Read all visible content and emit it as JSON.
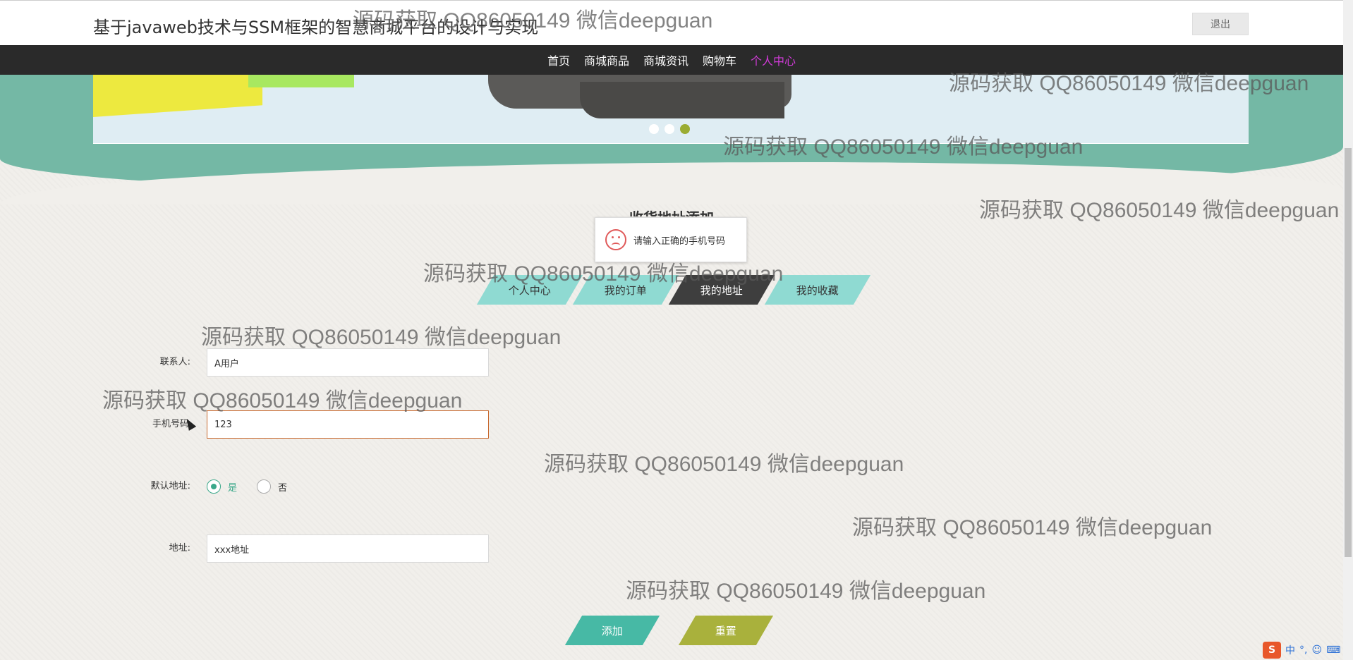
{
  "header": {
    "site_title": "基于javaweb技术与SSM框架的智慧商城平台的设计与实现",
    "logout_label": "退出"
  },
  "nav": {
    "items": [
      "首页",
      "商城商品",
      "商城资讯",
      "购物车",
      "个人中心"
    ],
    "active_index": 4
  },
  "banner": {
    "slide_count": 3,
    "active_slide": 3
  },
  "section_title": "收货地址添加",
  "toast": {
    "message": "请输入正确的手机号码",
    "icon": "sad-face-icon"
  },
  "tabs": {
    "items": [
      "个人中心",
      "我的订单",
      "我的地址",
      "我的收藏"
    ],
    "active_index": 2
  },
  "form": {
    "contact_label": "联系人:",
    "contact_value": "A用户",
    "phone_label": "手机号码",
    "phone_value": "123",
    "default_label": "默认地址:",
    "default_yes": "是",
    "default_no": "否",
    "default_selected": "是",
    "address_label": "地址:",
    "address_value": "xxx地址"
  },
  "actions": {
    "add_label": "添加",
    "reset_label": "重置"
  },
  "watermark": "源码获取 QQ86050149 微信deepguan",
  "ime": {
    "logo": "S",
    "mode": "中"
  },
  "colors": {
    "accent_teal": "#47b9a5",
    "accent_olive": "#a9b13c",
    "nav_active": "#d23bd9",
    "tab_bg": "#8fdad2",
    "tab_active": "#3e3e3e"
  }
}
